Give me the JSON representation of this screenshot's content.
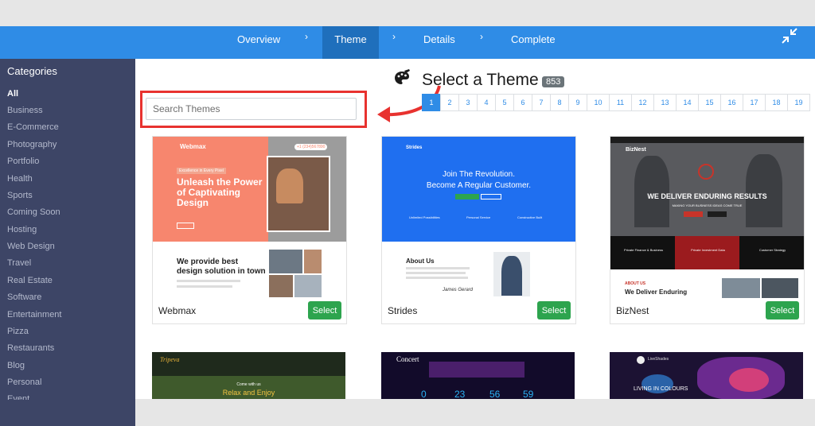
{
  "nav": {
    "steps": [
      "Overview",
      "Theme",
      "Details",
      "Complete"
    ],
    "separator": "›",
    "active": "Theme"
  },
  "sidebar": {
    "title": "Categories",
    "items": [
      "All",
      "Business",
      "E-Commerce",
      "Photography",
      "Portfolio",
      "Health",
      "Sports",
      "Coming Soon",
      "Hosting",
      "Web Design",
      "Travel",
      "Real Estate",
      "Software",
      "Entertainment",
      "Pizza",
      "Restaurants",
      "Blog",
      "Personal",
      "Event"
    ]
  },
  "header": {
    "title": "Select a Theme",
    "count": "853"
  },
  "search": {
    "placeholder": "Search Themes",
    "value": ""
  },
  "pagination": {
    "pages": [
      "1",
      "2",
      "3",
      "4",
      "5",
      "6",
      "7",
      "8",
      "9",
      "10",
      "11",
      "12",
      "13",
      "14",
      "15",
      "16",
      "17",
      "18",
      "19"
    ],
    "current": "1"
  },
  "themes": [
    {
      "name": "Webmax",
      "select_label": "Select",
      "preview": {
        "logo": "Webmax",
        "badge": "Excellence in Every Pixel",
        "headline1": "Unleash the Power",
        "headline2": "of Captivating",
        "headline3": "Design",
        "section1": "We provide best",
        "section2": "design solution in town",
        "phone": "+1 (234)567890"
      }
    },
    {
      "name": "Strides",
      "select_label": "Select",
      "preview": {
        "logo": "Strides",
        "headline1": "Join The Revolution.",
        "headline2": "Become A Regular Customer.",
        "f1": "Unlimited Possibilities",
        "f2": "Personal Service",
        "f3": "Constructive Built",
        "about": "About Us",
        "signature": "James Gerard"
      }
    },
    {
      "name": "BizNest",
      "select_label": "Select",
      "preview": {
        "logo": "BizNest",
        "headline": "WE DELIVER ENDURING RESULTS",
        "sub": "MAKING YOUR BUSINESS IDEAS COME TRUE",
        "s1": "Private Finance & Business",
        "s2": "Private Investment Data",
        "s3": "Customer Strategy",
        "about_tag": "ABOUT US",
        "about": "We Deliver Enduring"
      }
    }
  ],
  "themes_row2": [
    {
      "logo": "Tripeva",
      "tagline": "Come with us",
      "headline": "Relax and Enjoy"
    },
    {
      "logo": "Concert",
      "counts": [
        "0",
        "23",
        "56",
        "59"
      ]
    },
    {
      "logo": "LiveShades",
      "headline": "LIVING IN COLOURS"
    }
  ],
  "colors": {
    "nav": "#2f8ce6",
    "sidebar": "#3d4566",
    "select": "#2da44e",
    "highlight": "#e8322f"
  }
}
